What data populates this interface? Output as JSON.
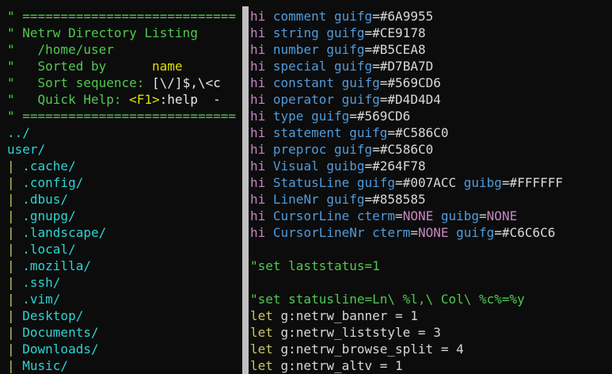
{
  "left_pane": {
    "lines": [
      {
        "segments": [
          {
            "t": "\" ============================",
            "c": "c-comment"
          }
        ]
      },
      {
        "segments": [
          {
            "t": "\" Netrw Directory Listing",
            "c": "c-comment"
          }
        ]
      },
      {
        "segments": [
          {
            "t": "\"   /home/user",
            "c": "c-comment"
          }
        ]
      },
      {
        "segments": [
          {
            "t": "\"   Sorted by      ",
            "c": "c-comment"
          },
          {
            "t": "name",
            "c": "c-name"
          }
        ]
      },
      {
        "segments": [
          {
            "t": "\"   Sort sequence: ",
            "c": "c-comment"
          },
          {
            "t": "[\\/]$,\\<c",
            "c": "c-white"
          }
        ]
      },
      {
        "segments": [
          {
            "t": "\"   Quick Help: ",
            "c": "c-comment"
          },
          {
            "t": "<F1>",
            "c": "c-key"
          },
          {
            "t": ":help  -",
            "c": "c-white"
          }
        ]
      },
      {
        "segments": [
          {
            "t": "\" ============================",
            "c": "c-comment"
          }
        ]
      },
      {
        "segments": [
          {
            "t": "../",
            "c": "c-dir"
          }
        ]
      },
      {
        "segments": [
          {
            "t": "user/",
            "c": "c-dir"
          }
        ]
      },
      {
        "segments": [
          {
            "t": "| ",
            "c": "c-treebar"
          },
          {
            "t": ".cache/",
            "c": "c-dir"
          }
        ]
      },
      {
        "segments": [
          {
            "t": "| ",
            "c": "c-treebar"
          },
          {
            "t": ".config/",
            "c": "c-dir"
          }
        ]
      },
      {
        "segments": [
          {
            "t": "| ",
            "c": "c-treebar"
          },
          {
            "t": ".dbus/",
            "c": "c-dir"
          }
        ]
      },
      {
        "segments": [
          {
            "t": "| ",
            "c": "c-treebar"
          },
          {
            "t": ".gnupg/",
            "c": "c-dir"
          }
        ]
      },
      {
        "segments": [
          {
            "t": "| ",
            "c": "c-treebar"
          },
          {
            "t": ".landscape/",
            "c": "c-dir"
          }
        ]
      },
      {
        "segments": [
          {
            "t": "| ",
            "c": "c-treebar"
          },
          {
            "t": ".local/",
            "c": "c-dir"
          }
        ]
      },
      {
        "segments": [
          {
            "t": "| ",
            "c": "c-treebar"
          },
          {
            "t": ".mozilla/",
            "c": "c-dir"
          }
        ]
      },
      {
        "segments": [
          {
            "t": "| ",
            "c": "c-treebar"
          },
          {
            "t": ".ssh/",
            "c": "c-dir"
          }
        ]
      },
      {
        "segments": [
          {
            "t": "| ",
            "c": "c-treebar"
          },
          {
            "t": ".vim/",
            "c": "c-dir"
          }
        ]
      },
      {
        "segments": [
          {
            "t": "| ",
            "c": "c-treebar"
          },
          {
            "t": "Desktop/",
            "c": "c-dir"
          }
        ]
      },
      {
        "segments": [
          {
            "t": "| ",
            "c": "c-treebar"
          },
          {
            "t": "Documents/",
            "c": "c-dir"
          }
        ]
      },
      {
        "segments": [
          {
            "t": "| ",
            "c": "c-treebar"
          },
          {
            "t": "Downloads/",
            "c": "c-dir"
          }
        ]
      },
      {
        "segments": [
          {
            "t": "| ",
            "c": "c-treebar"
          },
          {
            "t": "Music/",
            "c": "c-dir"
          }
        ]
      }
    ]
  },
  "right_pane": {
    "lines": [
      {
        "segments": [
          {
            "t": "hi ",
            "c": "c-hi"
          },
          {
            "t": "comment",
            "c": "c-grp"
          },
          {
            "t": " ",
            "c": "c-eq"
          },
          {
            "t": "guifg",
            "c": "c-grp"
          },
          {
            "t": "=#6A9955",
            "c": "c-val"
          }
        ]
      },
      {
        "segments": [
          {
            "t": "hi ",
            "c": "c-hi"
          },
          {
            "t": "string",
            "c": "c-grp"
          },
          {
            "t": " ",
            "c": "c-eq"
          },
          {
            "t": "guifg",
            "c": "c-grp"
          },
          {
            "t": "=#CE9178",
            "c": "c-val"
          }
        ]
      },
      {
        "segments": [
          {
            "t": "hi ",
            "c": "c-hi"
          },
          {
            "t": "number",
            "c": "c-grp"
          },
          {
            "t": " ",
            "c": "c-eq"
          },
          {
            "t": "guifg",
            "c": "c-grp"
          },
          {
            "t": "=#B5CEA8",
            "c": "c-val"
          }
        ]
      },
      {
        "segments": [
          {
            "t": "hi ",
            "c": "c-hi"
          },
          {
            "t": "special",
            "c": "c-grp"
          },
          {
            "t": " ",
            "c": "c-eq"
          },
          {
            "t": "guifg",
            "c": "c-grp"
          },
          {
            "t": "=#D7BA7D",
            "c": "c-val"
          }
        ]
      },
      {
        "segments": [
          {
            "t": "hi ",
            "c": "c-hi"
          },
          {
            "t": "constant",
            "c": "c-grp"
          },
          {
            "t": " ",
            "c": "c-eq"
          },
          {
            "t": "guifg",
            "c": "c-grp"
          },
          {
            "t": "=#569CD6",
            "c": "c-val"
          }
        ]
      },
      {
        "segments": [
          {
            "t": "hi ",
            "c": "c-hi"
          },
          {
            "t": "operator",
            "c": "c-grp"
          },
          {
            "t": " ",
            "c": "c-eq"
          },
          {
            "t": "guifg",
            "c": "c-grp"
          },
          {
            "t": "=#D4D4D4",
            "c": "c-val"
          }
        ]
      },
      {
        "segments": [
          {
            "t": "hi ",
            "c": "c-hi"
          },
          {
            "t": "type",
            "c": "c-grp"
          },
          {
            "t": " ",
            "c": "c-eq"
          },
          {
            "t": "guifg",
            "c": "c-grp"
          },
          {
            "t": "=#569CD6",
            "c": "c-val"
          }
        ]
      },
      {
        "segments": [
          {
            "t": "hi ",
            "c": "c-hi"
          },
          {
            "t": "statement",
            "c": "c-grp"
          },
          {
            "t": " ",
            "c": "c-eq"
          },
          {
            "t": "guifg",
            "c": "c-grp"
          },
          {
            "t": "=#C586C0",
            "c": "c-val"
          }
        ]
      },
      {
        "segments": [
          {
            "t": "hi ",
            "c": "c-hi"
          },
          {
            "t": "preproc",
            "c": "c-grp"
          },
          {
            "t": " ",
            "c": "c-eq"
          },
          {
            "t": "guifg",
            "c": "c-grp"
          },
          {
            "t": "=#C586C0",
            "c": "c-val"
          }
        ]
      },
      {
        "segments": [
          {
            "t": "hi ",
            "c": "c-hi"
          },
          {
            "t": "Visual",
            "c": "c-grp"
          },
          {
            "t": " ",
            "c": "c-eq"
          },
          {
            "t": "guibg",
            "c": "c-grp"
          },
          {
            "t": "=#264F78",
            "c": "c-val"
          }
        ]
      },
      {
        "segments": [
          {
            "t": "hi ",
            "c": "c-hi"
          },
          {
            "t": "StatusLine",
            "c": "c-grp"
          },
          {
            "t": " ",
            "c": "c-eq"
          },
          {
            "t": "guifg",
            "c": "c-grp"
          },
          {
            "t": "=#007ACC ",
            "c": "c-val"
          },
          {
            "t": "guibg",
            "c": "c-grp"
          },
          {
            "t": "=#FFFFFF",
            "c": "c-val"
          }
        ]
      },
      {
        "segments": [
          {
            "t": "hi ",
            "c": "c-hi"
          },
          {
            "t": "LineNr",
            "c": "c-grp"
          },
          {
            "t": " ",
            "c": "c-eq"
          },
          {
            "t": "guifg",
            "c": "c-grp"
          },
          {
            "t": "=#858585",
            "c": "c-val"
          }
        ]
      },
      {
        "segments": [
          {
            "t": "hi ",
            "c": "c-hi"
          },
          {
            "t": "CursorLine",
            "c": "c-grp"
          },
          {
            "t": " ",
            "c": "c-eq"
          },
          {
            "t": "cterm",
            "c": "c-grp"
          },
          {
            "t": "=",
            "c": "c-eq"
          },
          {
            "t": "NONE",
            "c": "c-none"
          },
          {
            "t": " ",
            "c": "c-eq"
          },
          {
            "t": "guibg",
            "c": "c-grp"
          },
          {
            "t": "=",
            "c": "c-eq"
          },
          {
            "t": "NONE",
            "c": "c-none"
          }
        ]
      },
      {
        "segments": [
          {
            "t": "hi ",
            "c": "c-hi"
          },
          {
            "t": "CursorLineNr",
            "c": "c-grp"
          },
          {
            "t": " ",
            "c": "c-eq"
          },
          {
            "t": "cterm",
            "c": "c-grp"
          },
          {
            "t": "=",
            "c": "c-eq"
          },
          {
            "t": "NONE",
            "c": "c-none"
          },
          {
            "t": " ",
            "c": "c-eq"
          },
          {
            "t": "guifg",
            "c": "c-grp"
          },
          {
            "t": "=#C6C6C6",
            "c": "c-val"
          }
        ]
      },
      {
        "segments": []
      },
      {
        "segments": [
          {
            "t": "\"set laststatus=1",
            "c": "c-strcomment"
          }
        ]
      },
      {
        "segments": []
      },
      {
        "segments": [
          {
            "t": "\"set statusline=Ln\\ %l,\\ Col\\ %c%=%y",
            "c": "c-strcomment"
          }
        ]
      },
      {
        "segments": [
          {
            "t": "let ",
            "c": "c-let"
          },
          {
            "t": "g:netrw_banner",
            "c": "c-var"
          },
          {
            "t": " = ",
            "c": "c-op"
          },
          {
            "t": "1",
            "c": "c-num"
          }
        ]
      },
      {
        "segments": [
          {
            "t": "let ",
            "c": "c-let"
          },
          {
            "t": "g:netrw_liststyle",
            "c": "c-var"
          },
          {
            "t": " = ",
            "c": "c-op"
          },
          {
            "t": "3",
            "c": "c-num"
          }
        ]
      },
      {
        "segments": [
          {
            "t": "let ",
            "c": "c-let"
          },
          {
            "t": "g:netrw_browse_split",
            "c": "c-var"
          },
          {
            "t": " = ",
            "c": "c-op"
          },
          {
            "t": "4",
            "c": "c-num"
          }
        ]
      },
      {
        "segments": [
          {
            "t": "let ",
            "c": "c-let"
          },
          {
            "t": "g:netrw_altv",
            "c": "c-var"
          },
          {
            "t": " = ",
            "c": "c-op"
          },
          {
            "t": "1",
            "c": "c-num"
          }
        ]
      }
    ]
  }
}
